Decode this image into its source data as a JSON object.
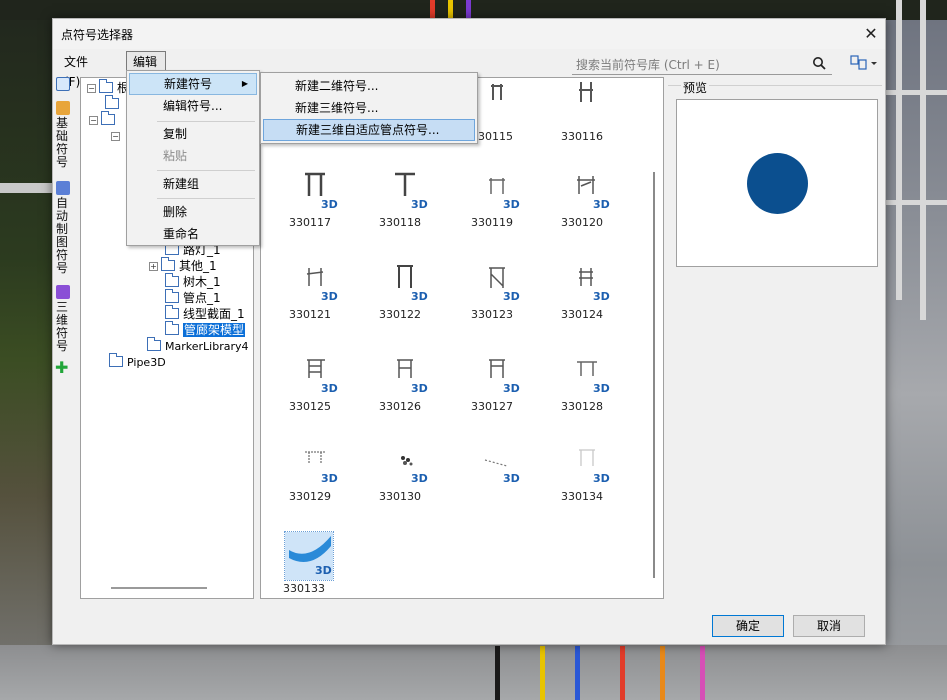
{
  "dialog": {
    "title": "点符号选择器",
    "close_glyph": "✕"
  },
  "menubar": {
    "file": "文件(F)",
    "edit": "编辑(E)"
  },
  "search": {
    "placeholder": "搜索当前符号库 (Ctrl + E)"
  },
  "vtabs": [
    {
      "label": "基础符号",
      "icon": "folder-icon"
    },
    {
      "label": "自动制图符号",
      "icon": "library-icon"
    },
    {
      "label": "三维符号",
      "icon": "cube-icon"
    }
  ],
  "tree": {
    "root": "根结",
    "items": [
      "路灯_1",
      "其他_1",
      "树木_1",
      "管点_1",
      "线型截面_1",
      "管廊架模型"
    ],
    "library4": "MarkerLibrary4",
    "pipe3d": "Pipe3D"
  },
  "edit_menu": {
    "items": [
      "新建符号",
      "编辑符号...",
      "复制",
      "粘贴",
      "新建组",
      "删除",
      "重命名"
    ],
    "submenu_arrow": "▶"
  },
  "new_symbol_submenu": {
    "items": [
      "新建二维符号...",
      "新建三维符号...",
      "新建三维自适应管点符号..."
    ]
  },
  "symbols": {
    "badge": "3D",
    "codes": [
      "330115",
      "330116",
      "330117",
      "330118",
      "330119",
      "330120",
      "330121",
      "330122",
      "330123",
      "330124",
      "330125",
      "330126",
      "330127",
      "330128",
      "330129",
      "330130",
      "330134",
      "330133"
    ]
  },
  "preview": {
    "label": "预览",
    "dot_color": "#0b4f8f"
  },
  "buttons": {
    "ok": "确定",
    "cancel": "取消"
  }
}
